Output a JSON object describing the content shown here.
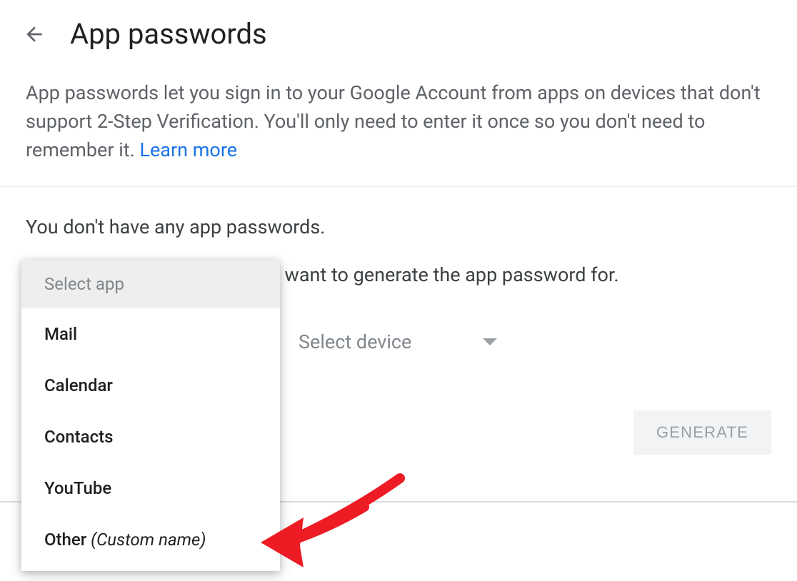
{
  "header": {
    "title": "App passwords"
  },
  "description": {
    "text": "App passwords let you sign in to your Google Account from apps on devices that don't support 2-Step Verification. You'll only need to enter it once so you don't need to remember it. ",
    "learn_more": "Learn more"
  },
  "status": "You don't have any app passwords.",
  "instruction": "Select the app and device you want to generate the app password for.",
  "select_device_label": "Select device",
  "generate_label": "GENERATE",
  "dropdown": {
    "header": "Select app",
    "items": [
      {
        "label": "Mail"
      },
      {
        "label": "Calendar"
      },
      {
        "label": "Contacts"
      },
      {
        "label": "YouTube"
      },
      {
        "label_main": "Other ",
        "label_italic": "(Custom name)"
      }
    ]
  }
}
